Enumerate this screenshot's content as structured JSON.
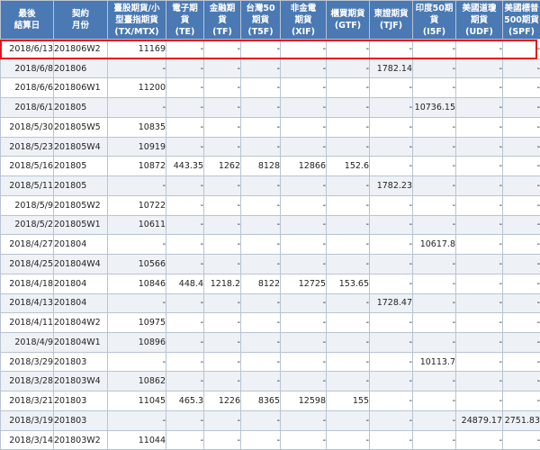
{
  "table": {
    "headers": [
      "最後\n結算日",
      "契約\n月份",
      "臺股期貨/小\n型臺指期貨\n(TX/MTX)",
      "電子期\n貨\n(TE)",
      "金融期\n貨\n(TF)",
      "台灣50\n期貨\n(T5F)",
      "非金電\n期貨\n(XIF)",
      "櫃買期貨\n(GTF)",
      "東證期貨\n(TJF)",
      "印度50期\n貨\n(I5F)",
      "美國道瓊\n期貨\n(UDF)",
      "美國標普\n500期貨\n(SPF)"
    ],
    "rows": [
      [
        "2018/6/13",
        "201806W2",
        "11169",
        "-",
        "-",
        "-",
        "-",
        "-",
        "-",
        "-",
        "-",
        "-"
      ],
      [
        "2018/6/8",
        "201806",
        "-",
        "-",
        "-",
        "-",
        "-",
        "-",
        "1782.14",
        "-",
        "-",
        "-"
      ],
      [
        "2018/6/6",
        "201806W1",
        "11200",
        "-",
        "-",
        "-",
        "-",
        "-",
        "-",
        "-",
        "-",
        "-"
      ],
      [
        "2018/6/1",
        "201805",
        "-",
        "-",
        "-",
        "-",
        "-",
        "-",
        "-",
        "10736.15",
        "-",
        "-"
      ],
      [
        "2018/5/30",
        "201805W5",
        "10835",
        "-",
        "-",
        "-",
        "-",
        "-",
        "-",
        "-",
        "-",
        "-"
      ],
      [
        "2018/5/23",
        "201805W4",
        "10919",
        "-",
        "-",
        "-",
        "-",
        "-",
        "-",
        "-",
        "-",
        "-"
      ],
      [
        "2018/5/16",
        "201805",
        "10872",
        "443.35",
        "1262",
        "8128",
        "12866",
        "152.6",
        "-",
        "-",
        "-",
        "-"
      ],
      [
        "2018/5/11",
        "201805",
        "-",
        "-",
        "-",
        "-",
        "-",
        "-",
        "1782.23",
        "-",
        "-",
        "-"
      ],
      [
        "2018/5/9",
        "201805W2",
        "10722",
        "-",
        "-",
        "-",
        "-",
        "-",
        "-",
        "-",
        "-",
        "-"
      ],
      [
        "2018/5/2",
        "201805W1",
        "10611",
        "-",
        "-",
        "-",
        "-",
        "-",
        "-",
        "-",
        "-",
        "-"
      ],
      [
        "2018/4/27",
        "201804",
        "-",
        "-",
        "-",
        "-",
        "-",
        "-",
        "-",
        "10617.8",
        "-",
        "-"
      ],
      [
        "2018/4/25",
        "201804W4",
        "10566",
        "-",
        "-",
        "-",
        "-",
        "-",
        "-",
        "-",
        "-",
        "-"
      ],
      [
        "2018/4/18",
        "201804",
        "10846",
        "448.4",
        "1218.2",
        "8122",
        "12725",
        "153.65",
        "-",
        "-",
        "-",
        "-"
      ],
      [
        "2018/4/13",
        "201804",
        "-",
        "-",
        "-",
        "-",
        "-",
        "-",
        "1728.47",
        "-",
        "-",
        "-"
      ],
      [
        "2018/4/11",
        "201804W2",
        "10975",
        "-",
        "-",
        "-",
        "-",
        "-",
        "-",
        "-",
        "-",
        "-"
      ],
      [
        "2018/4/9",
        "201804W1",
        "10896",
        "-",
        "-",
        "-",
        "-",
        "-",
        "-",
        "-",
        "-",
        "-"
      ],
      [
        "2018/3/29",
        "201803",
        "-",
        "-",
        "-",
        "-",
        "-",
        "-",
        "-",
        "10113.7",
        "-",
        "-"
      ],
      [
        "2018/3/28",
        "201803W4",
        "10862",
        "-",
        "-",
        "-",
        "-",
        "-",
        "-",
        "-",
        "-",
        "-"
      ],
      [
        "2018/3/21",
        "201803",
        "11045",
        "465.3",
        "1226",
        "8365",
        "12598",
        "155",
        "-",
        "-",
        "-",
        "-"
      ],
      [
        "2018/3/19",
        "201803",
        "-",
        "-",
        "-",
        "-",
        "-",
        "-",
        "-",
        "-",
        "24879.17",
        "2751.83"
      ],
      [
        "2018/3/14",
        "201803W2",
        "11044",
        "-",
        "-",
        "-",
        "-",
        "-",
        "-",
        "-",
        "-",
        "-"
      ]
    ]
  },
  "highlight": {
    "row_index": 0,
    "color": "#e8121b"
  }
}
